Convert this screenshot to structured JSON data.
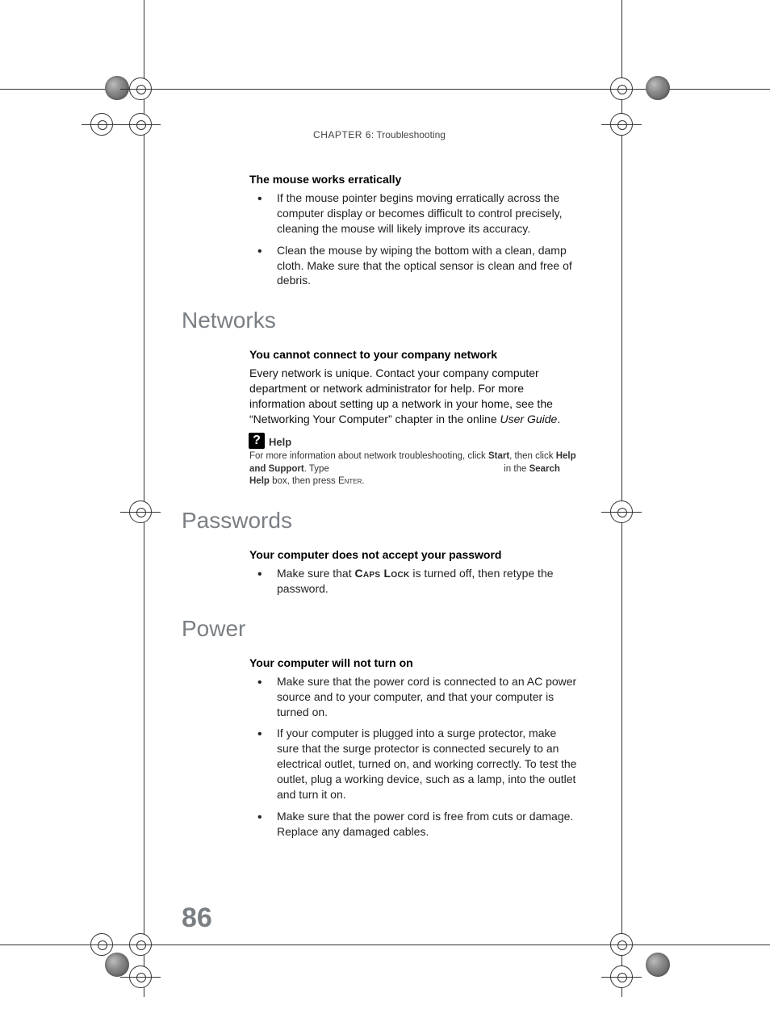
{
  "chapter": {
    "label": "CHAPTER 6",
    "title": "Troubleshooting"
  },
  "page_number": "86",
  "mouse": {
    "heading": "The mouse works erratically",
    "bullets": [
      "If the mouse pointer begins moving erratically across the computer display or becomes difficult to control precisely, cleaning the mouse will likely improve its accuracy.",
      "Clean the mouse by wiping the bottom with a clean, damp cloth. Make sure that the optical sensor is clean and free of debris."
    ]
  },
  "networks": {
    "section": "Networks",
    "heading": "You cannot connect to your company network",
    "para_pre": "Every network is unique. Contact your company computer department or network administrator for help. For more information about setting up a network in your home, see the “Networking Your Computer” chapter in the online ",
    "para_em": "User Guide",
    "para_post": ".",
    "help": {
      "title": "Help",
      "t1": "For more information about network troubleshooting, click ",
      "b1": "Start",
      "t2": ", then click ",
      "b2": "Help and Support",
      "t3": ". Type ",
      "t4": " in the ",
      "b3": "Search Help",
      "t5": " box, then press ",
      "sc": "Enter",
      "t6": "."
    }
  },
  "passwords": {
    "section": "Passwords",
    "heading": "Your computer does not accept your password",
    "bullet_pre": "Make sure that ",
    "bullet_caps": "Caps Lock",
    "bullet_post": " is turned off, then retype the password."
  },
  "power": {
    "section": "Power",
    "heading": "Your computer will not turn on",
    "bullets": [
      "Make sure that the power cord is connected to an AC power source and to your computer, and that your computer is turned on.",
      "If your computer is plugged into a surge protector, make sure that the surge protector is connected securely to an electrical outlet, turned on, and working correctly. To test the outlet, plug a working device, such as a lamp, into the outlet and turn it on.",
      "Make sure that the power cord is free from cuts or damage. Replace any damaged cables."
    ]
  }
}
